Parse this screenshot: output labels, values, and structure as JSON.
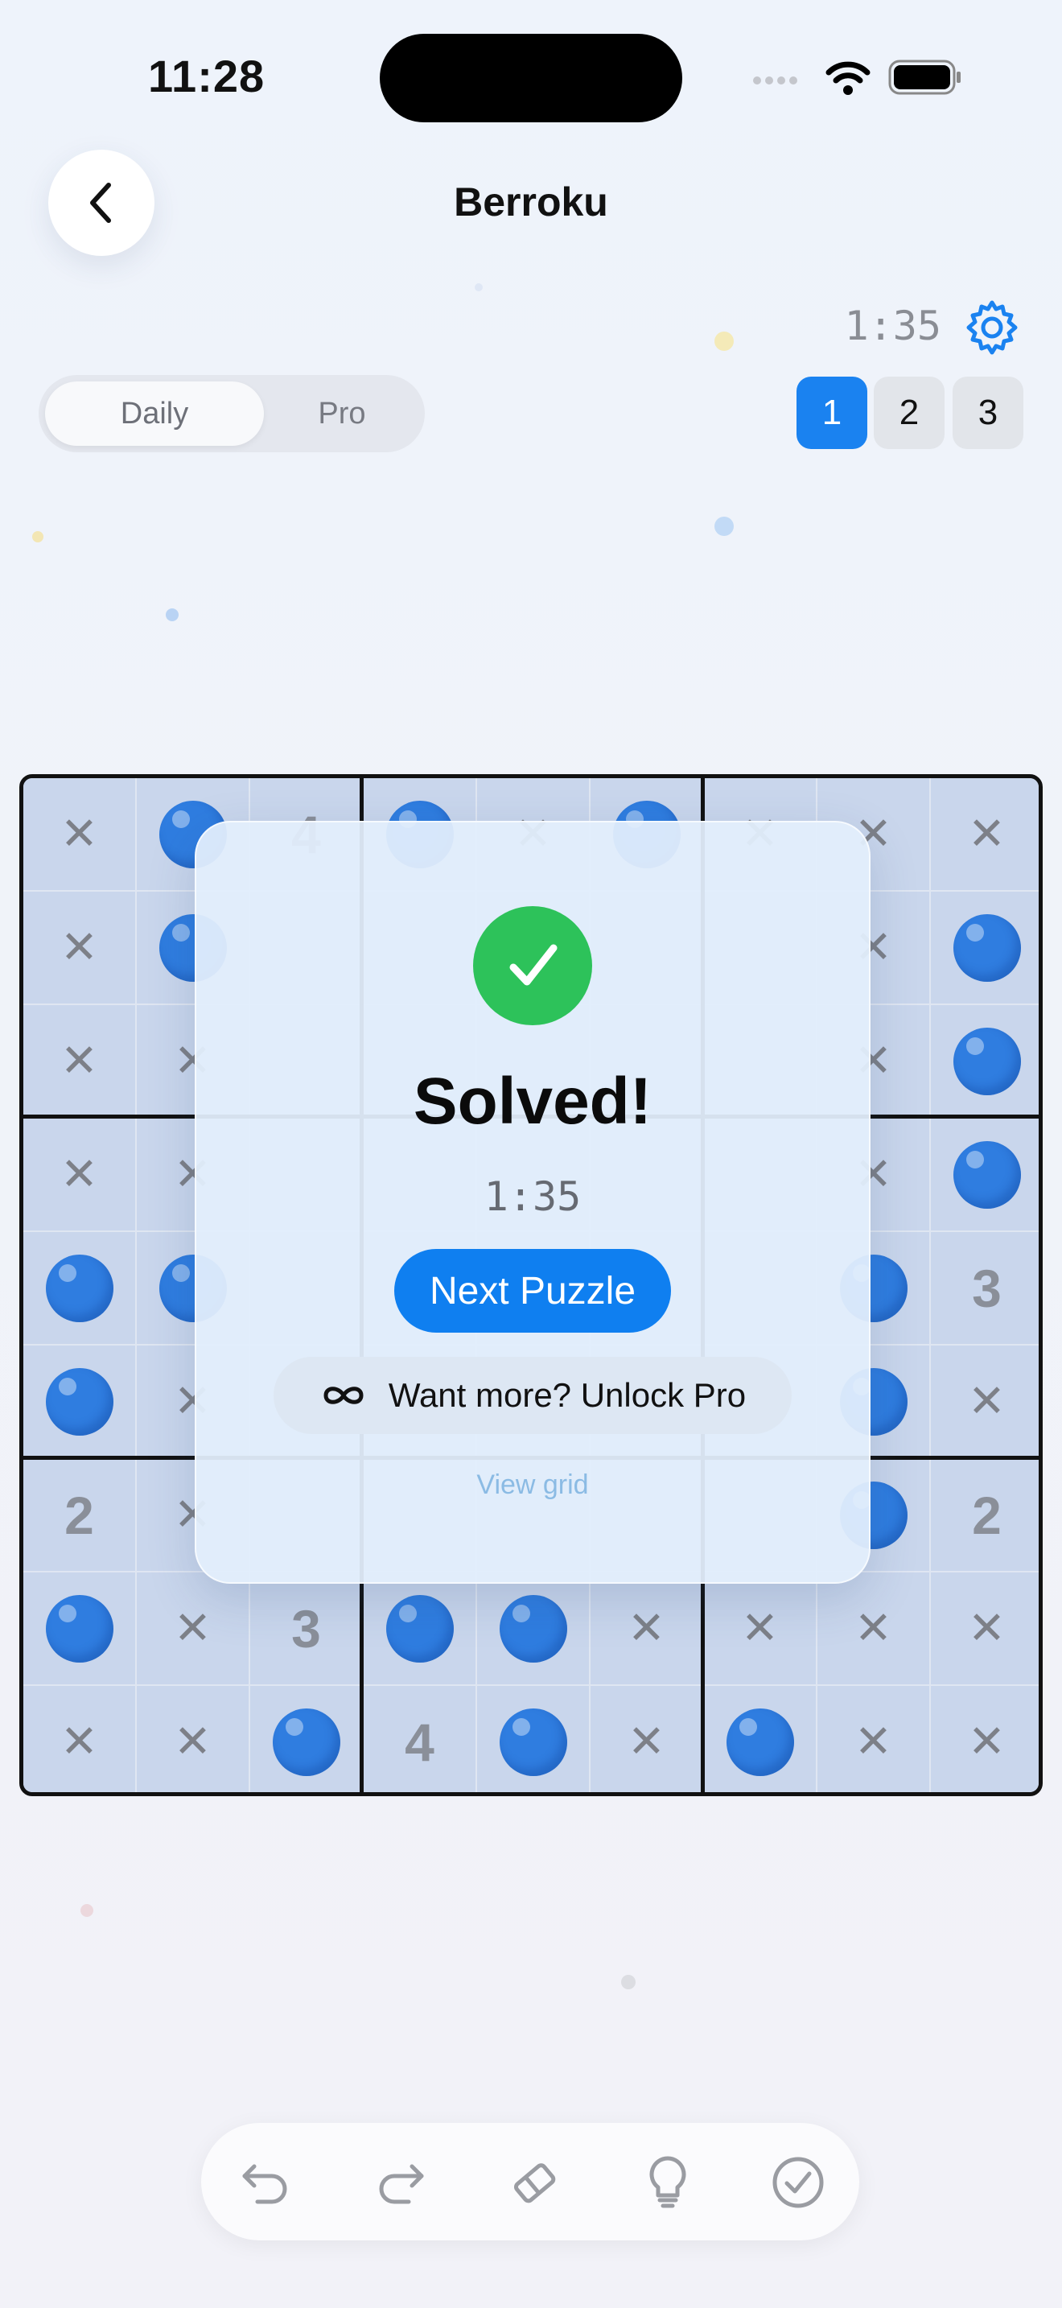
{
  "status_bar": {
    "time": "11:28"
  },
  "header": {
    "title": "Berroku",
    "timer": "1:35",
    "back_icon": "chevron-left-icon",
    "settings_icon": "gear-icon"
  },
  "mode_tabs": {
    "daily": "Daily",
    "pro": "Pro",
    "selected": "Daily"
  },
  "levels": [
    "1",
    "2",
    "3"
  ],
  "selected_level": "1",
  "colors": {
    "accent": "#1a82f0",
    "ball": "#2f7de0",
    "success": "#2dc25a",
    "cell": "#c9d6ec"
  },
  "grid": {
    "rows": [
      [
        "x",
        "o",
        "4",
        "o",
        "x",
        "o",
        "x",
        "x",
        "x"
      ],
      [
        "x",
        "o",
        "",
        "",
        "",
        "",
        "",
        "x",
        "o"
      ],
      [
        "x",
        "x",
        "",
        "",
        "",
        "",
        "",
        "x",
        "o"
      ],
      [
        "x",
        "x",
        "",
        "",
        "",
        "",
        "",
        "x",
        "o"
      ],
      [
        "o",
        "o",
        "",
        "",
        "",
        "",
        "",
        "o",
        "3"
      ],
      [
        "o",
        "x",
        "",
        "",
        "",
        "",
        "",
        "o",
        "x"
      ],
      [
        "2",
        "x",
        "",
        "",
        "",
        "",
        "",
        "o",
        "2"
      ],
      [
        "o",
        "x",
        "3",
        "o",
        "o",
        "x",
        "x",
        "x",
        "x"
      ],
      [
        "x",
        "x",
        "o",
        "4",
        "o",
        "x",
        "o",
        "x",
        "x"
      ]
    ]
  },
  "modal": {
    "title": "Solved!",
    "time": "1:35",
    "next_button": "Next Puzzle",
    "unlock_button": "Want more? Unlock Pro",
    "view_grid": "View grid"
  },
  "toolbar": [
    "undo-icon",
    "redo-icon",
    "eraser-icon",
    "hint-bulb-icon",
    "check-icon"
  ]
}
